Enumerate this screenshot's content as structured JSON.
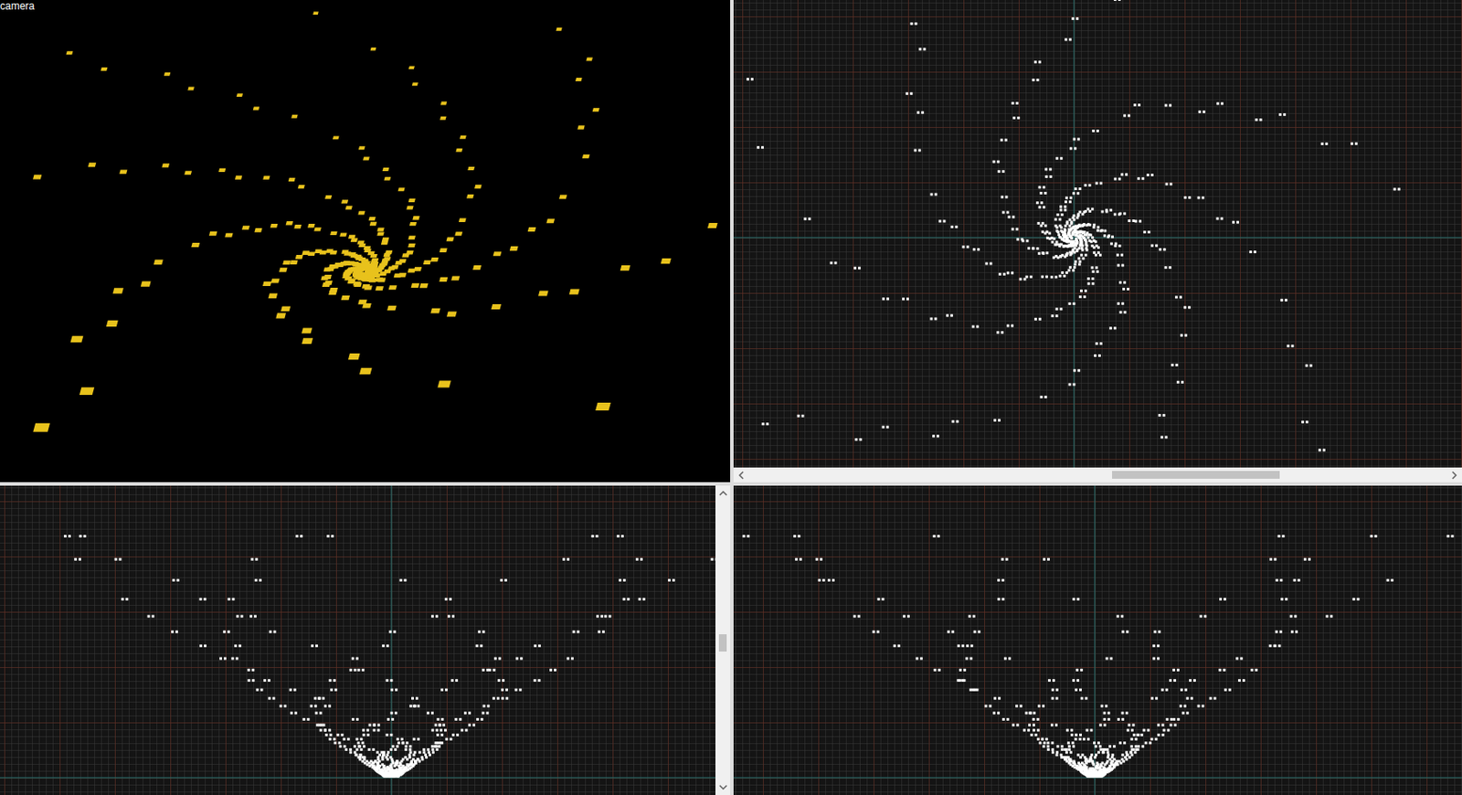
{
  "viewports": [
    {
      "kind": "camera",
      "label": "camera"
    },
    {
      "kind": "top",
      "label": "",
      "scrollbar": {
        "orientation": "horizontal",
        "level": 0.52
      }
    },
    {
      "kind": "front",
      "label": "",
      "scrollbar": {
        "orientation": "vertical",
        "level": 0.48
      }
    },
    {
      "kind": "side",
      "label": ""
    }
  ]
}
